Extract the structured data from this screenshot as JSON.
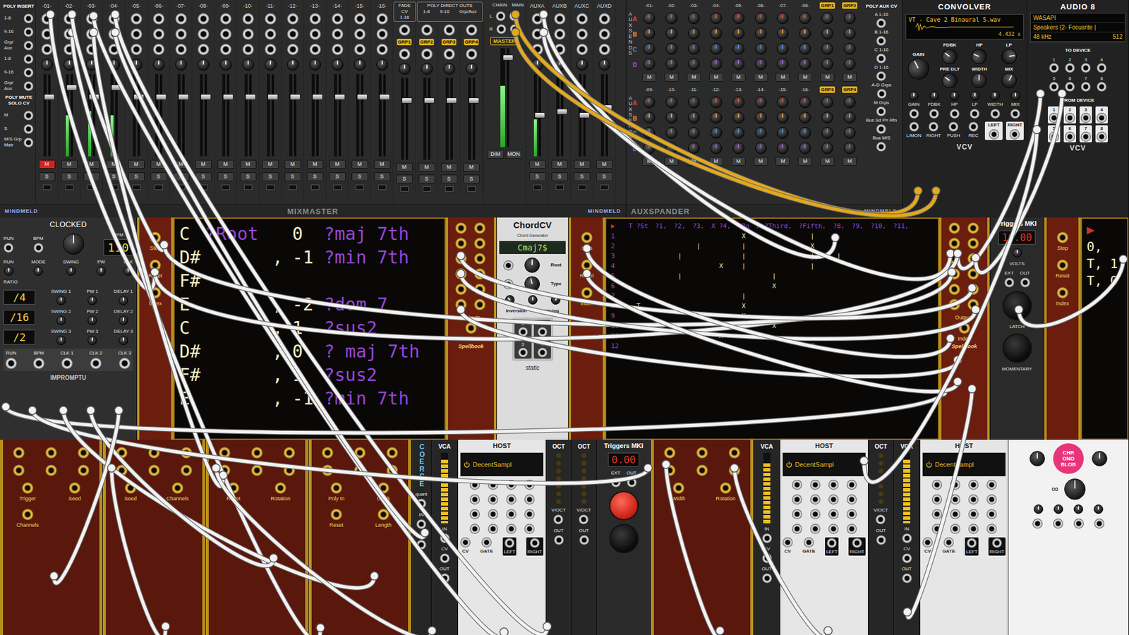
{
  "mixmaster": {
    "title": "MIXMASTER",
    "brand": "MINDMELD",
    "insert_title": "POLY INSERT",
    "insert_ports": [
      "1-8",
      "9-16",
      "Grp/ Aux",
      "1-8",
      "9-16",
      "Grp/ Aux"
    ],
    "ms_title": "POLY MUTE SOLO CV",
    "ms_ports": [
      "M",
      "S",
      "M/S Grp Mstr"
    ],
    "mute_label": "M",
    "solo_label": "S",
    "tracks": [
      {
        "label": "-01-",
        "fader": 0.74,
        "meter": 0,
        "muted": true,
        "soloed": false
      },
      {
        "label": "-02-",
        "fader": 0.86,
        "meter": 0.5,
        "muted": false,
        "soloed": false
      },
      {
        "label": "-03-",
        "fader": 0.74,
        "meter": 0.55,
        "muted": false,
        "soloed": false
      },
      {
        "label": "-04-",
        "fader": 0.86,
        "meter": 0.5,
        "muted": false,
        "soloed": false
      },
      {
        "label": "-05-",
        "fader": 0.74,
        "meter": 0,
        "muted": false,
        "soloed": false
      },
      {
        "label": "-06-",
        "fader": 0.74,
        "meter": 0,
        "muted": false,
        "soloed": false
      },
      {
        "label": "-07-",
        "fader": 0.74,
        "meter": 0,
        "muted": false,
        "soloed": false
      },
      {
        "label": "-08-",
        "fader": 0.74,
        "meter": 0,
        "muted": false,
        "soloed": false
      },
      {
        "label": "-09-",
        "fader": 0.74,
        "meter": 0,
        "muted": false,
        "soloed": false
      },
      {
        "label": "-10-",
        "fader": 0.74,
        "meter": 0,
        "muted": false,
        "soloed": false
      },
      {
        "label": "-11-",
        "fader": 0.74,
        "meter": 0,
        "muted": false,
        "soloed": false
      },
      {
        "label": "-12-",
        "fader": 0.74,
        "meter": 0,
        "muted": false,
        "soloed": false
      },
      {
        "label": "-13-",
        "fader": 0.74,
        "meter": 0,
        "muted": false,
        "soloed": false
      },
      {
        "label": "-14-",
        "fader": 0.74,
        "meter": 0,
        "muted": false,
        "soloed": false
      },
      {
        "label": "-15-",
        "fader": 0.74,
        "meter": 0,
        "muted": false,
        "soloed": false
      },
      {
        "label": "-16-",
        "fader": 0.74,
        "meter": 0,
        "muted": false,
        "soloed": false
      }
    ],
    "fade_title": "FADE CV",
    "fade_sub": "1-16",
    "direct_title": "POLY DIRECT OUTS",
    "direct_subs": [
      "1-8",
      "9-16",
      "Grp/Aux"
    ],
    "groups": [
      {
        "label": "GRP1",
        "fader": 0.74,
        "meter": 0,
        "muted": false,
        "soloed": false
      },
      {
        "label": "GRP2",
        "fader": 0.74,
        "meter": 0,
        "muted": false,
        "soloed": false
      },
      {
        "label": "GRP3",
        "fader": 0.74,
        "meter": 0,
        "muted": false,
        "soloed": false
      },
      {
        "label": "GRP4",
        "fader": 0.74,
        "meter": 0,
        "muted": false,
        "soloed": false
      }
    ],
    "chain_label": "CHAIN",
    "main_label": "MAIN",
    "lr": [
      "L",
      "R"
    ],
    "master": {
      "label": "MASTER",
      "fader": 0.93,
      "meter": 0.62,
      "dim": "DIM",
      "mon": "MON"
    },
    "aux_returns": [
      {
        "label": "AUXA",
        "fader": 0.5,
        "meter": 0.45,
        "muted": false,
        "soloed": false
      },
      {
        "label": "AUXB",
        "fader": 0.55,
        "meter": 0,
        "muted": false,
        "soloed": false
      },
      {
        "label": "AUXC",
        "fader": 0.5,
        "meter": 0,
        "muted": false,
        "soloed": false
      },
      {
        "label": "AUXD",
        "fader": 0.6,
        "meter": 0,
        "muted": false,
        "soloed": false
      }
    ]
  },
  "auxspander": {
    "title": "AUXSPANDER",
    "brand": "MINDMELD",
    "sends_title": "AUX SENDS",
    "mute_label": "M",
    "sends": [
      {
        "label": "A",
        "color": "#e5473d"
      },
      {
        "label": "B",
        "color": "#f29a2e"
      },
      {
        "label": "C",
        "color": "#3d8ee5"
      },
      {
        "label": "D",
        "color": "#9b59e0"
      }
    ],
    "banks": [
      {
        "columns": [
          {
            "label": "-01-",
            "kind": "track"
          },
          {
            "label": "-02-",
            "kind": "track"
          },
          {
            "label": "-03-",
            "kind": "track"
          },
          {
            "label": "-04-",
            "kind": "track"
          },
          {
            "label": "-05-",
            "kind": "track"
          },
          {
            "label": "-06-",
            "kind": "track"
          },
          {
            "label": "-07-",
            "kind": "track"
          },
          {
            "label": "-08-",
            "kind": "track"
          },
          {
            "label": "GRP1",
            "kind": "group"
          },
          {
            "label": "GRP2",
            "kind": "group"
          }
        ]
      },
      {
        "columns": [
          {
            "label": "-09-",
            "kind": "track"
          },
          {
            "label": "-10-",
            "kind": "track"
          },
          {
            "label": "-11-",
            "kind": "track"
          },
          {
            "label": "-12-",
            "kind": "track"
          },
          {
            "label": "-13-",
            "kind": "track"
          },
          {
            "label": "-14-",
            "kind": "track"
          },
          {
            "label": "-15-",
            "kind": "track"
          },
          {
            "label": "-16-",
            "kind": "track"
          },
          {
            "label": "GRP3",
            "kind": "group"
          },
          {
            "label": "GRP4",
            "kind": "group"
          }
        ]
      }
    ],
    "poly_title": "POLY AUX CV",
    "poly_ports": [
      "A 1-16",
      "B 1-16",
      "C 1-16",
      "D 1-16",
      "A-D Grps",
      "M Grps",
      "Bus Sd Pn Rtn",
      "Bus M/S"
    ]
  },
  "convolver": {
    "title": "CONVOLVER",
    "file": "VT - Cave 2 Binaural 5.wav",
    "length": "4.432 s",
    "gain": {
      "label": "GAIN",
      "level": 0.4
    },
    "knobs": [
      {
        "label": "FDBK",
        "level": 0.3
      },
      {
        "label": "HP",
        "level": 0.25
      },
      {
        "label": "LP",
        "level": 0.8
      },
      {
        "label": "PRE DLY",
        "level": 0.3
      },
      {
        "label": "WIDTH",
        "level": 0.5
      },
      {
        "label": "MIX",
        "level": 0.6
      }
    ],
    "cv_labels": [
      "GAIN",
      "FDBK",
      "HP",
      "LP",
      "WIDTH",
      "MIX"
    ],
    "ports": [
      "L/MON",
      "RIGHT",
      "PUSH",
      "REC"
    ],
    "outputs": [
      "LEFT",
      "RIGHT"
    ],
    "brand": "VCV"
  },
  "audio8": {
    "title": "AUDIO 8",
    "driver": "WASAPI",
    "device": "Speakers (2- Focusrite |",
    "rate": "48 kHz",
    "block": "512",
    "to_title": "TO DEVICE",
    "to_ports": [
      "1",
      "2",
      "3",
      "4",
      "5",
      "6",
      "7",
      "8"
    ],
    "from_title": "FROM DEVICE",
    "from_ports": [
      "1",
      "2",
      "3",
      "4",
      "5",
      "6",
      "7",
      "8"
    ],
    "brand": "VCV"
  },
  "clocked": {
    "title": "CLOCKED",
    "brand": "IMPROMPTU",
    "run_label": "RUN",
    "bpm_label": "BPM",
    "bpm": "110",
    "mode_row": [
      "RUN",
      "MODE",
      "SWING",
      "PW",
      "CLK"
    ],
    "ratio_label": "RATIO",
    "subclocks": [
      {
        "ratio": "/4",
        "labels": [
          "SWING 1",
          "PW 1",
          "DELAY 1"
        ]
      },
      {
        "ratio": "/16",
        "labels": [
          "SWING 2",
          "PW 2",
          "DELAY 2"
        ]
      },
      {
        "ratio": "/2",
        "labels": [
          "SWING 3",
          "PW 3",
          "DELAY 3"
        ]
      }
    ],
    "outputs": [
      "RUN",
      "BPM",
      "CLK 1",
      "CLK 2",
      "CLK 3"
    ]
  },
  "spellbook_left": {
    "inputs": [
      "Step",
      "Reset",
      "Index"
    ],
    "outputs_label": "Outputs",
    "index_label": "Index",
    "title": "Spellbook",
    "lines": [
      {
        "note": "C",
        "tag": "?Root",
        "sep": "",
        "value": "0",
        "type": "?maj 7th"
      },
      {
        "note": "D#",
        "tag": "",
        "sep": ",",
        "value": "-1",
        "type": "?min 7th"
      },
      {
        "note": "F#",
        "tag": "",
        "sep": "",
        "value": "",
        "type": ""
      },
      {
        "note": "E",
        "tag": "",
        "sep": ",",
        "value": "-2",
        "type": "?dom 7"
      },
      {
        "note": "C",
        "tag": "",
        "sep": ",",
        "value": "1",
        "type": "?sus2"
      },
      {
        "note": "D#",
        "tag": "",
        "sep": ",",
        "value": "0",
        "type": "? maj 7th"
      },
      {
        "note": "F#",
        "tag": "",
        "sep": ",",
        "value": "1",
        "type": "?sus2"
      },
      {
        "note": "E",
        "tag": "",
        "sep": ",",
        "value": "-1",
        "type": "?min 7th"
      }
    ]
  },
  "chordcv": {
    "title": "ChordCV",
    "subtitle": "Chord Generator",
    "display": "Cmaj7$",
    "root": {
      "label": "Root",
      "level": 0.5
    },
    "type": {
      "label": "Type",
      "level": 0.45
    },
    "small_knobs": [
      0.35,
      0.5,
      0.6
    ],
    "small_labels": [
      "Inversion",
      "Voicing"
    ],
    "outputs": [
      "1",
      "2",
      "3",
      "4"
    ],
    "brand": "static"
  },
  "spellbook_right": {
    "inputs": [
      "Step",
      "Reset",
      "Index"
    ],
    "outputs_label": "Outputs",
    "index_label": "Index",
    "title": "Spellbook",
    "marker": "▶",
    "header": [
      "T ?St",
      "?1,",
      "?2,",
      "?3,",
      "X ?4,",
      "?Ro",
      "X ?Third,",
      "?Fifth,",
      "?8,",
      "?9,",
      "?10,",
      "?11,"
    ],
    "rows": [
      {
        "num": "1",
        "cells": [
          "",
          "",
          "",
          "",
          "",
          "X",
          "",
          "|",
          "",
          "",
          "",
          ""
        ]
      },
      {
        "num": "2",
        "cells": [
          "",
          "",
          "",
          "|",
          "",
          "|",
          "",
          "X",
          "",
          "",
          "",
          ""
        ]
      },
      {
        "num": "3",
        "cells": [
          "",
          "",
          "|",
          "",
          "",
          "|",
          "",
          "|",
          "|",
          "",
          "",
          ""
        ]
      },
      {
        "num": "4",
        "cells": [
          "",
          "",
          "",
          "",
          "X",
          "|",
          "",
          "|",
          "",
          "",
          "",
          ""
        ]
      },
      {
        "num": "5",
        "cells": [
          "",
          "",
          "|",
          "",
          "",
          "",
          "|",
          "",
          "",
          "",
          "",
          ""
        ]
      },
      {
        "num": "6",
        "cells": [
          "",
          "",
          "",
          "",
          "",
          "",
          "X",
          "",
          "",
          "",
          "",
          ""
        ]
      },
      {
        "num": "7",
        "cells": [
          "",
          "",
          "",
          "",
          "",
          "|",
          "",
          "",
          "",
          "",
          "",
          ""
        ]
      },
      {
        "num": "8",
        "cells": [
          "T",
          "",
          "",
          "",
          "",
          "X",
          "",
          "",
          "",
          "",
          "",
          ""
        ]
      },
      {
        "num": "9",
        "cells": [
          "",
          "",
          "",
          "",
          "",
          "X",
          "",
          "",
          "",
          "",
          "",
          ""
        ]
      },
      {
        "num": "10",
        "cells": [
          "",
          "X",
          "",
          "",
          "",
          "",
          "X",
          "",
          "",
          "",
          "",
          ""
        ]
      },
      {
        "num": "11",
        "cells": [
          "",
          "",
          "",
          "",
          "X",
          "",
          "",
          "",
          "",
          "",
          "",
          ""
        ]
      },
      {
        "num": "12",
        "cells": [
          "",
          "",
          "",
          "",
          "",
          "",
          "",
          "X",
          "",
          "",
          "",
          ""
        ]
      }
    ]
  },
  "triggers": {
    "title": "Triggers MKI",
    "display": "10.00",
    "volts": "VOLTS",
    "ext": "EXT",
    "out": "OUT",
    "latch": "LATCH",
    "momentary": "MOMENTARY"
  },
  "spellbook_edge": {
    "inputs": [
      "Step",
      "Reset",
      "Index"
    ],
    "marker": "▶",
    "lines": [
      "0,",
      "T, 1",
      "T, 0"
    ]
  },
  "row3": [
    {
      "kind": "gold",
      "labels": [
        "Trigger",
        "Seed",
        "Channels"
      ]
    },
    {
      "kind": "gold",
      "labels": [
        "Seed",
        "Channels"
      ]
    },
    {
      "kind": "gold",
      "labels": [
        "Reset",
        "Rotation"
      ]
    },
    {
      "kind": "gold",
      "labels": [
        "Poly In",
        "Clock",
        "Reset",
        "Length"
      ]
    },
    {
      "kind": "coerce",
      "title": "COERCE",
      "labels": [
        "quant",
        "IN",
        "OUT"
      ]
    },
    {
      "kind": "vca",
      "title": "VCA",
      "level": 0.9,
      "labels": [
        "IN",
        "CV",
        "OUT"
      ]
    },
    {
      "kind": "host",
      "title": "HOST",
      "plugin": "DecentSampl",
      "labels": [
        "CV",
        "GATE",
        "LEFT",
        "RIGHT"
      ]
    },
    {
      "kind": "oct",
      "title": "OCT",
      "labels": [
        "V/OCT",
        "OUT"
      ]
    },
    {
      "kind": "oct",
      "title": "OCT",
      "labels": [
        "V/OCT",
        "OUT"
      ]
    },
    {
      "kind": "triggers",
      "title": "Triggers MKI",
      "display": "0.00",
      "labels": [
        "EXT",
        "OUT"
      ]
    },
    {
      "kind": "gold",
      "labels": [
        "Width",
        "Rotation"
      ]
    },
    {
      "kind": "vca",
      "title": "VCA",
      "level": 0.85,
      "labels": [
        "IN",
        "CV",
        "OUT"
      ]
    },
    {
      "kind": "host",
      "title": "HOST",
      "plugin": "DecentSampl",
      "labels": [
        "CV",
        "GATE",
        "LEFT",
        "RIGHT"
      ]
    },
    {
      "kind": "oct",
      "title": "OCT",
      "labels": [
        "V/OCT",
        "OUT"
      ]
    },
    {
      "kind": "vca",
      "title": "VCA",
      "level": 0.9,
      "labels": [
        "IN",
        "CV",
        "OUT"
      ]
    },
    {
      "kind": "host",
      "title": "HOST",
      "plugin": "DecentSampl",
      "labels": [
        "CV",
        "GATE",
        "LEFT",
        "RIGHT"
      ]
    },
    {
      "kind": "chrono",
      "lines": [
        "CHR",
        "ONO",
        "BLOB"
      ],
      "labels": [
        "∞"
      ]
    }
  ],
  "cables": [
    {
      "color": "#f2f2f2"
    },
    {
      "color": "#f2f2f2"
    },
    {
      "color": "#f2f2f2"
    },
    {
      "color": "#f2f2f2"
    },
    {
      "color": "#f2f2f2"
    },
    {
      "color": "#f2f2f2"
    },
    {
      "color": "#f2f2f2"
    },
    {
      "color": "#f2f2f2"
    },
    {
      "color": "#f2f2f2"
    },
    {
      "color": "#f2f2f2"
    },
    {
      "color": "#f2f2f2"
    },
    {
      "color": "#f2f2f2"
    },
    {
      "color": "#f2f2f2"
    },
    {
      "color": "#f2f2f2"
    },
    {
      "color": "#f2f2f2"
    },
    {
      "color": "#f2f2f2"
    },
    {
      "color": "#f2f2f2"
    },
    {
      "color": "#f2f2f2"
    },
    {
      "color": "#f2f2f2"
    },
    {
      "color": "#f2f2f2"
    },
    {
      "color": "#f2f2f2"
    },
    {
      "color": "#f2f2f2"
    },
    {
      "color": "#f2f2f2"
    },
    {
      "color": "#f2f2f2"
    },
    {
      "color": "#f2f2f2"
    },
    {
      "color": "#f2f2f2"
    },
    {
      "color": "#f2f2f2"
    },
    {
      "color": "#f2f2f2"
    },
    {
      "color": "#f2f2f2"
    },
    {
      "color": "#f2f2f2"
    },
    {
      "color": "#e3a91c"
    },
    {
      "color": "#e3a91c"
    }
  ]
}
